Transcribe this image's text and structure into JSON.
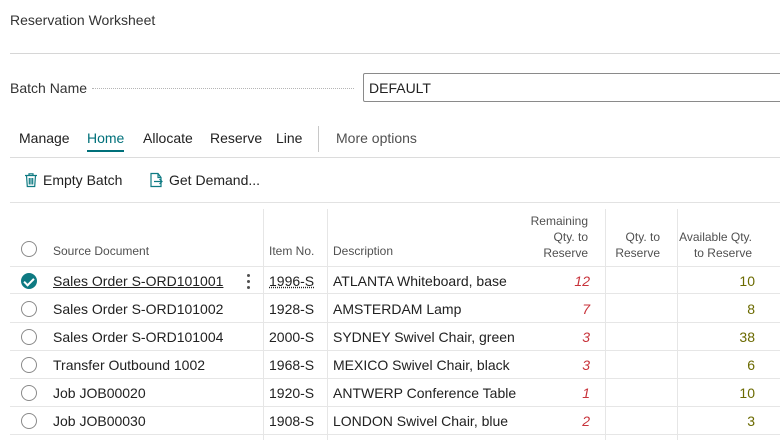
{
  "page": {
    "title": "Reservation Worksheet"
  },
  "batch": {
    "label": "Batch Name",
    "value": "DEFAULT"
  },
  "tabs": {
    "manage": "Manage",
    "home": "Home",
    "allocate": "Allocate",
    "reserve": "Reserve",
    "line": "Line",
    "more": "More options"
  },
  "actions": {
    "empty_batch": "Empty Batch",
    "get_demand": "Get Demand..."
  },
  "grid": {
    "headers": {
      "source_document": "Source Document",
      "item_no": "Item No.",
      "description": "Description",
      "remaining_1": "Remaining",
      "remaining_2": "Qty. to",
      "remaining_3": "Reserve",
      "qty_1": "Qty. to",
      "qty_2": "Reserve",
      "avail_1": "Available Qty.",
      "avail_2": "to Reserve"
    },
    "rows": [
      {
        "source": "Sales Order S-ORD101001",
        "item": "1996-S",
        "description": "ATLANTA Whiteboard, base",
        "remaining": "12",
        "qty": "",
        "available": "10"
      },
      {
        "source": "Sales Order S-ORD101002",
        "item": "1928-S",
        "description": "AMSTERDAM Lamp",
        "remaining": "7",
        "qty": "",
        "available": "8"
      },
      {
        "source": "Sales Order S-ORD101004",
        "item": "2000-S",
        "description": "SYDNEY Swivel Chair, green",
        "remaining": "3",
        "qty": "",
        "available": "38"
      },
      {
        "source": "Transfer Outbound 1002",
        "item": "1968-S",
        "description": "MEXICO Swivel Chair, black",
        "remaining": "3",
        "qty": "",
        "available": "6"
      },
      {
        "source": "Job JOB00020",
        "item": "1920-S",
        "description": "ANTWERP Conference Table",
        "remaining": "1",
        "qty": "",
        "available": "10"
      },
      {
        "source": "Job JOB00030",
        "item": "1908-S",
        "description": "LONDON Swivel Chair, blue",
        "remaining": "2",
        "qty": "",
        "available": "3"
      }
    ]
  },
  "colors": {
    "accent": "#00707a",
    "negative": "#c8323a",
    "available": "#6b6a00"
  },
  "icons": {
    "empty_batch": "trash-icon",
    "get_demand": "import-icon",
    "row_menu": "more-vertical-icon"
  }
}
